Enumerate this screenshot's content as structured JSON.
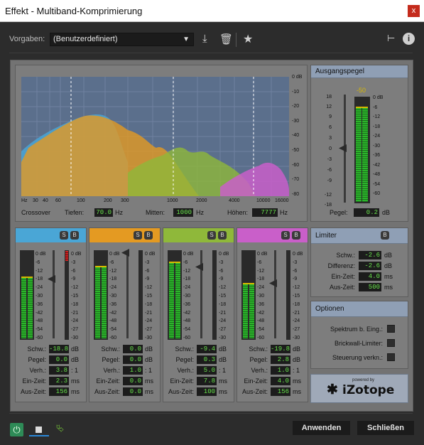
{
  "window": {
    "title": "Effekt - Multiband-Komprimierung",
    "close": "x"
  },
  "toolbar": {
    "preset_label": "Vorgaben:",
    "preset_value": "(Benutzerdefiniert)"
  },
  "spectrum": {
    "db_labels": [
      "0 dB",
      "-10",
      "-20",
      "-30",
      "-40",
      "-50",
      "-60",
      "-70",
      "-80"
    ],
    "hz_labels": [
      "Hz",
      "30",
      "40",
      "60",
      "100",
      "200",
      "300",
      "1000",
      "2000",
      "4000",
      "10000",
      "16000"
    ],
    "crossover_label": "Crossover",
    "low_label": "Tiefen:",
    "low_value": "70.0",
    "mid_label": "Mitten:",
    "mid_value": "1000",
    "high_label": "Höhen:",
    "high_value": "7777",
    "hz": "Hz",
    "colors": {
      "blue": "#4aa6d6",
      "orange": "#e49a22",
      "green": "#8fb83a",
      "magenta": "#c95fc9"
    }
  },
  "output": {
    "title": "Ausgangspegel",
    "peak": "-50",
    "scale": [
      "18",
      "12",
      "9",
      "6",
      "3",
      "0",
      "-3",
      "-6",
      "-9",
      "-12",
      "-18"
    ],
    "meter_scale": [
      "0 dB",
      "-6",
      "-12",
      "-18",
      "-24",
      "-30",
      "-36",
      "-42",
      "-48",
      "-54",
      "-60"
    ],
    "gain_label": "Pegel:",
    "gain_value": "0.2",
    "unit": "dB"
  },
  "bands": [
    {
      "color": "#4aa6d6",
      "threshold": "-18.8",
      "gain": "0.0",
      "ratio": "3.8",
      "attack": "2.3",
      "release": "156"
    },
    {
      "color": "#e49a22",
      "threshold": "0.0",
      "gain": "0.0",
      "ratio": "1.0",
      "attack": "0.0",
      "release": "0.0"
    },
    {
      "color": "#8fb83a",
      "threshold": "-9.4",
      "gain": "0.3",
      "ratio": "5.0",
      "attack": "7.8",
      "release": "100"
    },
    {
      "color": "#c95fc9",
      "threshold": "-19.8",
      "gain": "2.8",
      "ratio": "1.0",
      "attack": "4.0",
      "release": "156"
    }
  ],
  "band_labels": {
    "s": "S",
    "b": "B",
    "threshold": "Schw.:",
    "gain": "Pegel:",
    "ratio": "Verh.:",
    "attack": "Ein-Zeit:",
    "release": "Aus-Zeit:",
    "db": "dB",
    "ratio_unit": ": 1",
    "ms": "ms"
  },
  "band_meter_scale": [
    "0 dB",
    "-6",
    "-12",
    "-18",
    "-24",
    "-30",
    "-36",
    "-42",
    "-48",
    "-54",
    "-60"
  ],
  "band_gr_scale": [
    "0 dB",
    "-3",
    "-6",
    "-9",
    "-12",
    "-15",
    "-18",
    "-21",
    "-24",
    "-27",
    "-30"
  ],
  "limiter": {
    "title": "Limiter",
    "b": "B",
    "threshold_label": "Schw.:",
    "threshold": "-2.6",
    "margin_label": "Differenz:",
    "margin": "-2.6",
    "attack_label": "Ein-Zeit:",
    "attack": "4.0",
    "release_label": "Aus-Zeit:",
    "release": "500",
    "db": "dB",
    "ms": "ms"
  },
  "options": {
    "title": "Optionen",
    "items": [
      "Spektrum b. Eing.:",
      "Brickwall-Limiter:",
      "Steuerung verkn.:"
    ]
  },
  "logo": {
    "powered": "powered by",
    "brand": "iZotope"
  },
  "footer": {
    "apply": "Anwenden",
    "close": "Schließen"
  }
}
